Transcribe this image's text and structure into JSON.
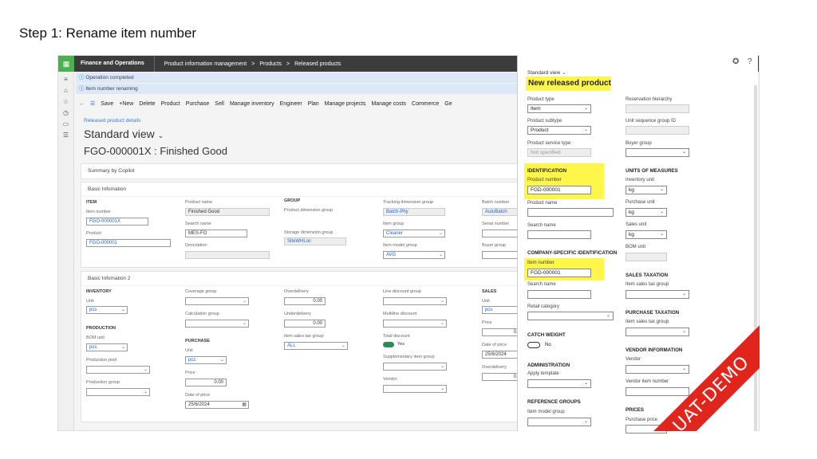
{
  "heading": "Step 1: Rename item number",
  "topbar": {
    "app": "Finance and Operations",
    "crumbs": [
      "Product information management",
      ">",
      "Products",
      ">",
      "Released products"
    ]
  },
  "messages": [
    "Operation completed",
    "Item number renaming"
  ],
  "actions": [
    "Save",
    "+New",
    "Delete",
    "Product",
    "Purchase",
    "Sell",
    "Manage inventory",
    "Engineer",
    "Plan",
    "Manage projects",
    "Manage costs",
    "Commerce",
    "Ge"
  ],
  "subtitle": "Released product details",
  "view": "Standard view",
  "record": "FGO-000001X : Finished Good",
  "summary": "Summary by Copilot",
  "basic1": {
    "title": "Basic Infomation",
    "item_group": "ITEM",
    "item_number_label": "Item number",
    "item_number": "FGO-000001X",
    "product_label": "Product",
    "product": "FGO-000001",
    "product_name_label": "Product name",
    "product_name": "Finished Good",
    "search_name_label": "Search name",
    "search_name": "MES-FO",
    "description_label": "Description",
    "group_group": "GROUP",
    "pdg_label": "Product dimension group",
    "sdg_label": "Storage dimension group",
    "sdg": "SiteWHLoc",
    "tdg_label": "Tracking dimension group",
    "tdg": "Batch-Phy",
    "item_group_label": "Item group",
    "item_group_val": "Cleaner",
    "img_label": "Item model group",
    "img": "AVG",
    "batch_label": "Batch number",
    "batch": "AutoBatch",
    "serial_label": "Serial number",
    "buyer_label": "Buyer group"
  },
  "basic2": {
    "title": "Basic Infomation 2",
    "inv_group": "INVENTORY",
    "unit_label": "Unit",
    "unit": "pcs",
    "prod_group": "PRODUCTION",
    "bom_label": "BOM unit",
    "bom": "pcs",
    "pool_label": "Production pool",
    "pgroup_label": "Production group",
    "coverage_label": "Coverage group",
    "calc_label": "Calculation group",
    "purch_group": "PURCHASE",
    "punit_label": "Unit",
    "punit": "pcs",
    "price_label": "Price",
    "price": "0.00",
    "dop_label": "Date of price",
    "dop": "25/6/2024",
    "over_label": "Overdelivery",
    "over": "0.00",
    "under_label": "Underdelivery",
    "under": "0.00",
    "tax_label": "Item sales tax group",
    "tax": "ALL",
    "line_label": "Line discount group",
    "multi_label": "Multiline discount",
    "total_label": "Total discount",
    "total": "Yes",
    "supp_label": "Supplementary item group",
    "vendor_label": "Vendor",
    "sales_group": "SALES",
    "sunit_label": "Unit",
    "sunit": "pcs",
    "sprice_label": "Price",
    "sprice": "0.0",
    "sdop_label": "Date of price",
    "sdop": "25/6/2024",
    "sover_label": "Overdelivery",
    "sover": "0.0"
  },
  "dialog": {
    "view": "Standard view",
    "title": "New released product",
    "ptype_label": "Product type",
    "ptype": "Item",
    "psub_label": "Product subtype",
    "psub": "Product",
    "pst_label": "Product service type",
    "pst": "Not specified",
    "ident": "IDENTIFICATION",
    "pnum_label": "Product number",
    "pnum": "FGD-000001",
    "pname_label": "Product name",
    "sname_label": "Search name",
    "csi": "COMPANY-SPECIFIC IDENTIFICATION",
    "inum_label": "Item number",
    "inum": "FGD-000001",
    "sname2_label": "Search name",
    "retail_label": "Retail category",
    "cw": "CATCH WEIGHT",
    "cw_val": "No",
    "admin": "ADMINISTRATION",
    "apply_label": "Apply template",
    "ref": "REFERENCE GROUPS",
    "img_label": "Item model group",
    "rh_label": "Reservation hierarchy",
    "usg_label": "Unit sequence group ID",
    "bg_label": "Buyer group",
    "uom": "UNITS OF MEASURES",
    "iu_label": "Inventory unit",
    "iu": "kg",
    "pu_label": "Purchase unit",
    "pu": "kg",
    "su_label": "Sales unit",
    "su": "kg",
    "bom_label": "BOM unit",
    "stax": "SALES TAXATION",
    "ist_label": "Item sales tax group",
    "ptax": "PURCHASE TAXATION",
    "ipt_label": "Item sales tax group",
    "vi": "VENDOR INFORMATION",
    "vendor_label": "Vendor",
    "vin_label": "Vendor item number",
    "prices": "PRICES",
    "pp_label": "Purchase price"
  },
  "ribbon": "UAT-DEMO",
  "colors": {
    "highlight": "#fff64a",
    "ribbon": "#e0261c",
    "waffle": "#4caf50"
  }
}
